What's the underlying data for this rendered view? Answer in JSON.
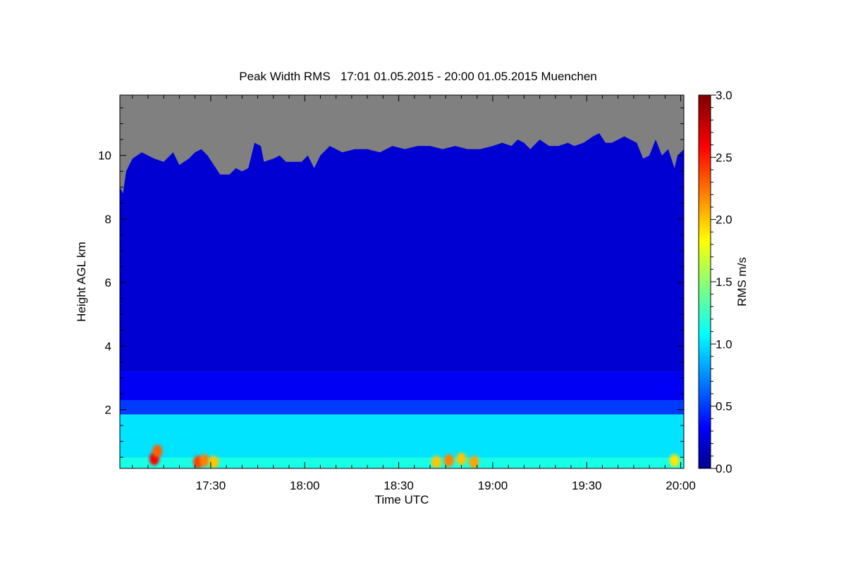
{
  "chart_data": {
    "type": "heatmap",
    "title": "Peak Width RMS   17:01 01.05.2015 - 20:00 01.05.2015 Muenchen",
    "xlabel": "Time UTC",
    "ylabel": "Height AGL km",
    "x_unit": "minutes UTC",
    "xlim": [
      1021,
      1201
    ],
    "ylim": [
      0.15,
      11.9
    ],
    "x_ticks": [
      {
        "value": 1050,
        "label": "17:30"
      },
      {
        "value": 1080,
        "label": "18:00"
      },
      {
        "value": 1110,
        "label": "18:30"
      },
      {
        "value": 1140,
        "label": "19:00"
      },
      {
        "value": 1170,
        "label": "19:30"
      },
      {
        "value": 1200,
        "label": "20:00"
      }
    ],
    "y_ticks": [
      {
        "value": 2,
        "label": "2"
      },
      {
        "value": 4,
        "label": "4"
      },
      {
        "value": 6,
        "label": "6"
      },
      {
        "value": 8,
        "label": "8"
      },
      {
        "value": 10,
        "label": "10"
      }
    ],
    "colorbar": {
      "label": "RMS m/s",
      "range": [
        0,
        3.0
      ],
      "ticks": [
        {
          "value": 0.0,
          "label": "0.0"
        },
        {
          "value": 0.5,
          "label": "0.5"
        },
        {
          "value": 1.0,
          "label": "1.0"
        },
        {
          "value": 1.5,
          "label": "1.5"
        },
        {
          "value": 2.0,
          "label": "2.0"
        },
        {
          "value": 2.5,
          "label": "2.5"
        },
        {
          "value": 3.0,
          "label": "3.0"
        }
      ],
      "colormap": "jet"
    },
    "no_data_color": "#808080",
    "data_top_height_km": [
      [
        1021,
        9.0
      ],
      [
        1022,
        8.8
      ],
      [
        1023,
        9.5
      ],
      [
        1025,
        9.9
      ],
      [
        1028,
        10.1
      ],
      [
        1032,
        9.9
      ],
      [
        1035,
        9.8
      ],
      [
        1038,
        10.1
      ],
      [
        1040,
        9.7
      ],
      [
        1043,
        9.9
      ],
      [
        1045,
        10.1
      ],
      [
        1047,
        10.2
      ],
      [
        1049,
        10.0
      ],
      [
        1051,
        9.7
      ],
      [
        1053,
        9.4
      ],
      [
        1056,
        9.4
      ],
      [
        1058,
        9.6
      ],
      [
        1060,
        9.5
      ],
      [
        1062,
        9.6
      ],
      [
        1064,
        10.4
      ],
      [
        1066,
        10.3
      ],
      [
        1067,
        9.8
      ],
      [
        1070,
        9.9
      ],
      [
        1072,
        10.0
      ],
      [
        1074,
        9.8
      ],
      [
        1077,
        9.8
      ],
      [
        1079,
        9.8
      ],
      [
        1081,
        10.0
      ],
      [
        1083,
        9.6
      ],
      [
        1085,
        10.0
      ],
      [
        1088,
        10.3
      ],
      [
        1092,
        10.1
      ],
      [
        1096,
        10.2
      ],
      [
        1100,
        10.2
      ],
      [
        1104,
        10.1
      ],
      [
        1108,
        10.3
      ],
      [
        1112,
        10.2
      ],
      [
        1116,
        10.3
      ],
      [
        1120,
        10.3
      ],
      [
        1124,
        10.2
      ],
      [
        1128,
        10.3
      ],
      [
        1132,
        10.2
      ],
      [
        1136,
        10.2
      ],
      [
        1140,
        10.3
      ],
      [
        1143,
        10.4
      ],
      [
        1146,
        10.3
      ],
      [
        1148,
        10.5
      ],
      [
        1150,
        10.4
      ],
      [
        1152,
        10.2
      ],
      [
        1155,
        10.5
      ],
      [
        1158,
        10.3
      ],
      [
        1161,
        10.3
      ],
      [
        1164,
        10.4
      ],
      [
        1166,
        10.3
      ],
      [
        1169,
        10.4
      ],
      [
        1172,
        10.6
      ],
      [
        1174,
        10.7
      ],
      [
        1176,
        10.4
      ],
      [
        1178,
        10.4
      ],
      [
        1180,
        10.5
      ],
      [
        1182,
        10.6
      ],
      [
        1184,
        10.5
      ],
      [
        1186,
        10.4
      ],
      [
        1188,
        9.9
      ],
      [
        1190,
        10.0
      ],
      [
        1192,
        10.5
      ],
      [
        1194,
        10.0
      ],
      [
        1196,
        10.2
      ],
      [
        1198,
        9.6
      ],
      [
        1199,
        10.0
      ],
      [
        1201,
        10.2
      ]
    ],
    "layers": [
      {
        "height_km": [
          0.15,
          0.5
        ],
        "rms": 1.15
      },
      {
        "height_km": [
          0.5,
          1.85
        ],
        "rms": 1.0
      },
      {
        "height_km": [
          1.85,
          2.3
        ],
        "rms": 0.5
      },
      {
        "height_km": [
          2.3,
          3.2
        ],
        "rms": 0.3
      },
      {
        "height_km": [
          3.2,
          10.8
        ],
        "rms": 0.2
      }
    ],
    "hotspots": [
      {
        "x": 1032,
        "y": 0.45,
        "rms": 2.6
      },
      {
        "x": 1033,
        "y": 0.7,
        "rms": 2.3
      },
      {
        "x": 1046,
        "y": 0.35,
        "rms": 2.4
      },
      {
        "x": 1048,
        "y": 0.4,
        "rms": 2.2
      },
      {
        "x": 1051,
        "y": 0.35,
        "rms": 2.0
      },
      {
        "x": 1122,
        "y": 0.35,
        "rms": 2.0
      },
      {
        "x": 1126,
        "y": 0.4,
        "rms": 2.2
      },
      {
        "x": 1130,
        "y": 0.45,
        "rms": 2.0
      },
      {
        "x": 1134,
        "y": 0.35,
        "rms": 2.1
      },
      {
        "x": 1198,
        "y": 0.4,
        "rms": 1.9
      }
    ],
    "grid": false,
    "legend": "none"
  }
}
